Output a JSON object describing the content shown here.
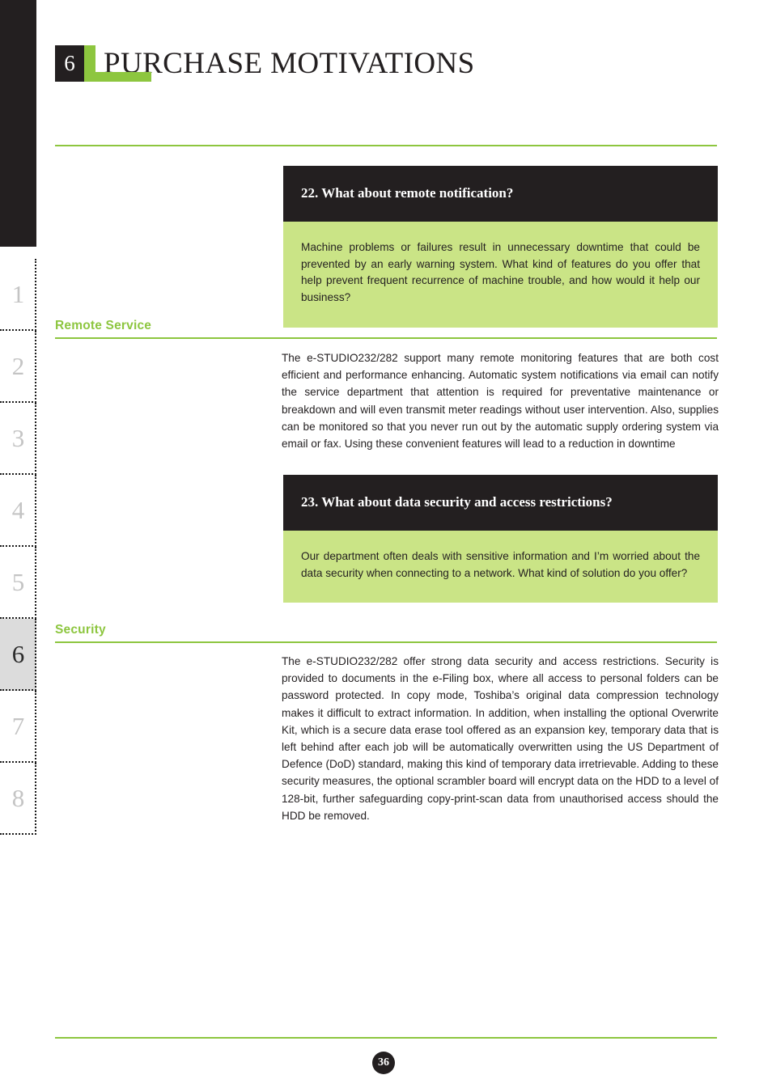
{
  "header": {
    "chapter_number": "6",
    "title": "PURCHASE MOTIVATIONS"
  },
  "sidebar": {
    "tabs": [
      {
        "label": "1",
        "active": false
      },
      {
        "label": "2",
        "active": false
      },
      {
        "label": "3",
        "active": false
      },
      {
        "label": "4",
        "active": false
      },
      {
        "label": "5",
        "active": false
      },
      {
        "label": "6",
        "active": true
      },
      {
        "label": "7",
        "active": false
      },
      {
        "label": "8",
        "active": false
      }
    ]
  },
  "questions": [
    {
      "heading": "22. What about remote notification?",
      "body": "Machine problems or failures result in unnecessary downtime that could be prevented by an early warning system. What kind of features do you offer that help prevent frequent recurrence of machine trouble, and how would it help our business?"
    },
    {
      "heading": "23. What about data security and access restrictions?",
      "body": "Our department often deals with sensitive information and I’m worried about the data security when connecting to a network. What kind of solution do you offer?"
    }
  ],
  "sections": [
    {
      "label": "Remote Service",
      "answer": "The e-STUDIO232/282 support many remote monitoring features that are both cost efficient and performance enhancing. Automatic system notifications via email can notify the service department that attention is required for preventative maintenance or breakdown and will even transmit meter readings without user intervention. Also, supplies can be monitored so that you never run out by the automatic supply ordering system via email or fax. Using these convenient features will lead to a reduction in downtime"
    },
    {
      "label": "Security",
      "answer": "The e-STUDIO232/282 offer strong data security and access restrictions. Security is provided to documents in the e-Filing box, where all access to personal folders can be password protected. In copy mode, Toshiba’s original data compression technology makes it difficult to extract information. In addition, when installing the optional Overwrite Kit, which is a secure data erase tool offered as an expansion key, temporary data that is left behind after each job will be automatically overwritten using the US Department of Defence (DoD) standard, making  this kind of temporary data irretrievable. Adding to these security measures, the optional scrambler board will encrypt data on the HDD to a level of 128-bit, further safeguarding copy-print-scan data from unauthorised access should the HDD be removed."
    }
  ],
  "footer": {
    "page_number": "36"
  },
  "colors": {
    "accent_green": "#8dc63f",
    "box_green": "#cae486",
    "dark": "#231f20",
    "tab_active_bg": "#dcdcdc"
  }
}
